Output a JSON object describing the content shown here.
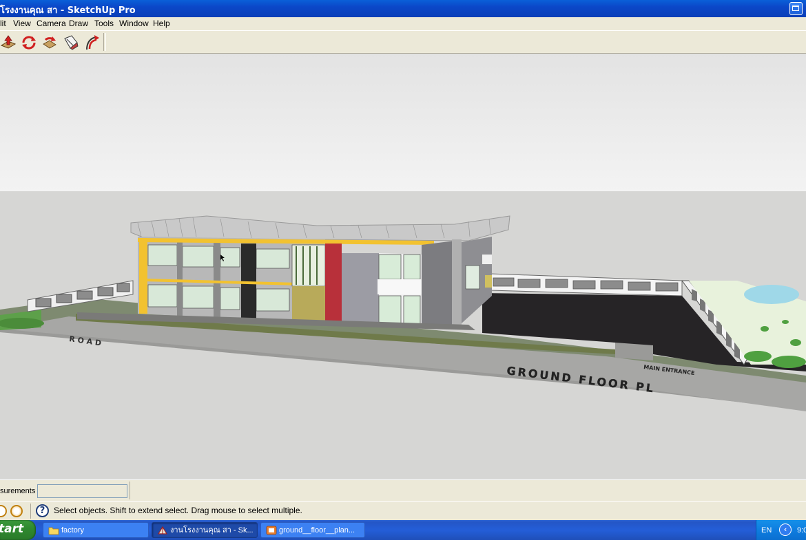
{
  "window": {
    "title": "โรงงานคุณ สา - SketchUp Pro"
  },
  "menu": [
    "lit",
    "View",
    "Camera",
    "Draw",
    "Tools",
    "Window",
    "Help"
  ],
  "toolbar": {
    "tools": [
      "push-pull-icon",
      "orbit-icon",
      "rotate-icon",
      "paint-bucket-icon",
      "follow-me-icon"
    ]
  },
  "viewport": {
    "scene_labels": {
      "road": "R O A D",
      "ground_floor": "GROUND   FLOOR   PL",
      "main_entrance": "MAIN  ENTRANCE"
    }
  },
  "measurements": {
    "label": "surements",
    "value": ""
  },
  "status": {
    "text": "Select objects. Shift to extend select. Drag mouse to select multiple."
  },
  "taskbar": {
    "start_label": "tart",
    "tasks": [
      {
        "label": "factory",
        "icon": "folder-icon"
      },
      {
        "label": "งานโรงงานคุณ สา - Sk...",
        "icon": "sketchup-icon"
      },
      {
        "label": "ground__floor__plan...",
        "icon": "image-viewer-icon"
      }
    ],
    "language": "EN",
    "clock": "9:0"
  },
  "colors": {
    "titlebar": "#0b47c8",
    "chrome": "#ece9d8",
    "sky": "#e0e0e0",
    "ground": "#d5d5d3",
    "taskbar": "#245ed8",
    "start": "#2f8a2f"
  }
}
